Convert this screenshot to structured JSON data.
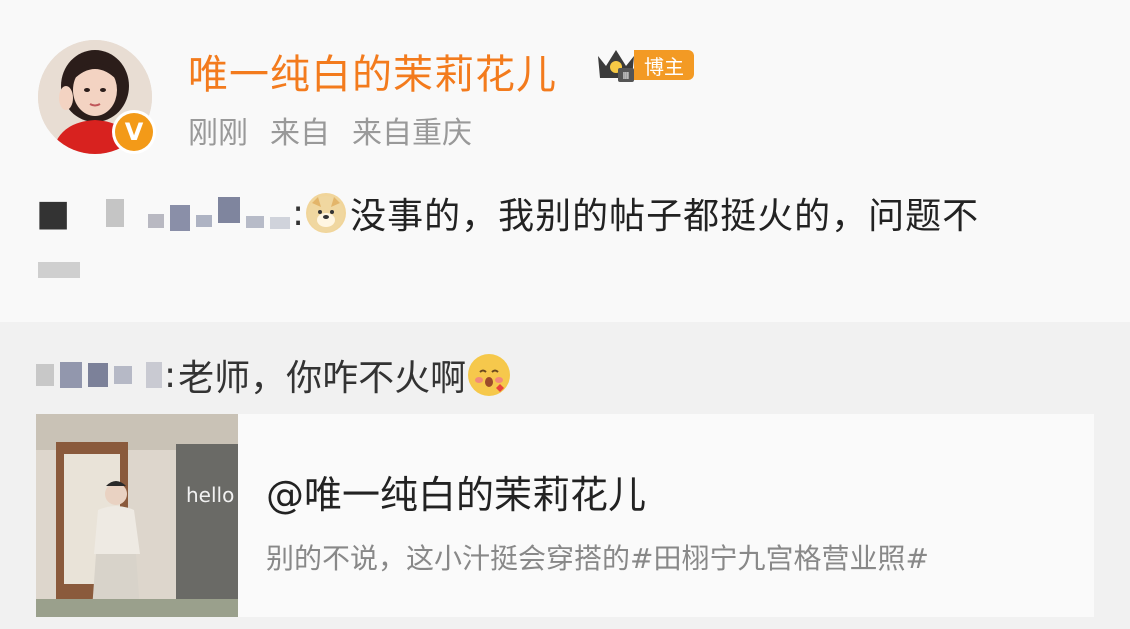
{
  "post": {
    "author": {
      "name": "唯一纯白的茉莉花儿",
      "badge_label": "博主",
      "verified_mark": "V",
      "avatar_icon": "avatar-photo"
    },
    "meta": {
      "time": "刚刚",
      "source_prefix": "来自",
      "source": "来自重庆"
    }
  },
  "comment": {
    "avatar_glyph": "■",
    "colon": ":",
    "text": "没事的，我别的帖子都挺火的，问题不",
    "emoji": "doge-emoji"
  },
  "reply": {
    "colon": ":",
    "text": "老师，你咋不火啊",
    "emoji": "blush-emoji"
  },
  "card": {
    "title": "@唯一纯白的茉莉花儿",
    "description": "别的不说，这小汁挺会穿搭的#田栩宁九宫格营业照#",
    "photo_text": "hello"
  },
  "colors": {
    "username": "#f37b1d",
    "badge": "#f39a24",
    "meta_text": "#999999"
  }
}
